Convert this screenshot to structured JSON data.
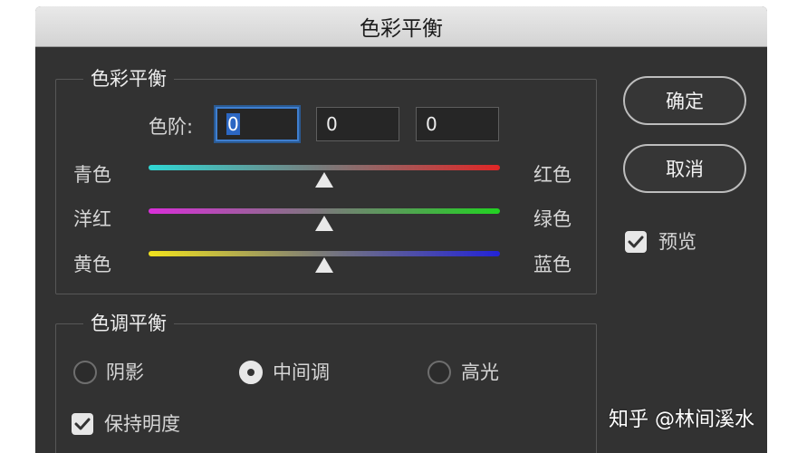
{
  "window": {
    "title": "色彩平衡"
  },
  "color_balance": {
    "group_title": "色彩平衡",
    "levels_label": "色阶:",
    "levels": [
      "0",
      "0",
      "0"
    ],
    "sliders": [
      {
        "left": "青色",
        "right": "红色",
        "value": 0,
        "left_color": "#2fd7d4",
        "right_color": "#e02626"
      },
      {
        "left": "洋红",
        "right": "绿色",
        "value": 0,
        "left_color": "#d92fd9",
        "right_color": "#22d322"
      },
      {
        "left": "黄色",
        "right": "蓝色",
        "value": 0,
        "left_color": "#f1e21d",
        "right_color": "#2323d6"
      }
    ]
  },
  "tone_balance": {
    "group_title": "色调平衡",
    "options": [
      "阴影",
      "中间调",
      "高光"
    ],
    "selected": "中间调",
    "preserve_luminosity_label": "保持明度",
    "preserve_luminosity_checked": true
  },
  "buttons": {
    "ok": "确定",
    "cancel": "取消"
  },
  "preview": {
    "label": "预览",
    "checked": true
  },
  "watermark": "知乎 @林间溪水"
}
